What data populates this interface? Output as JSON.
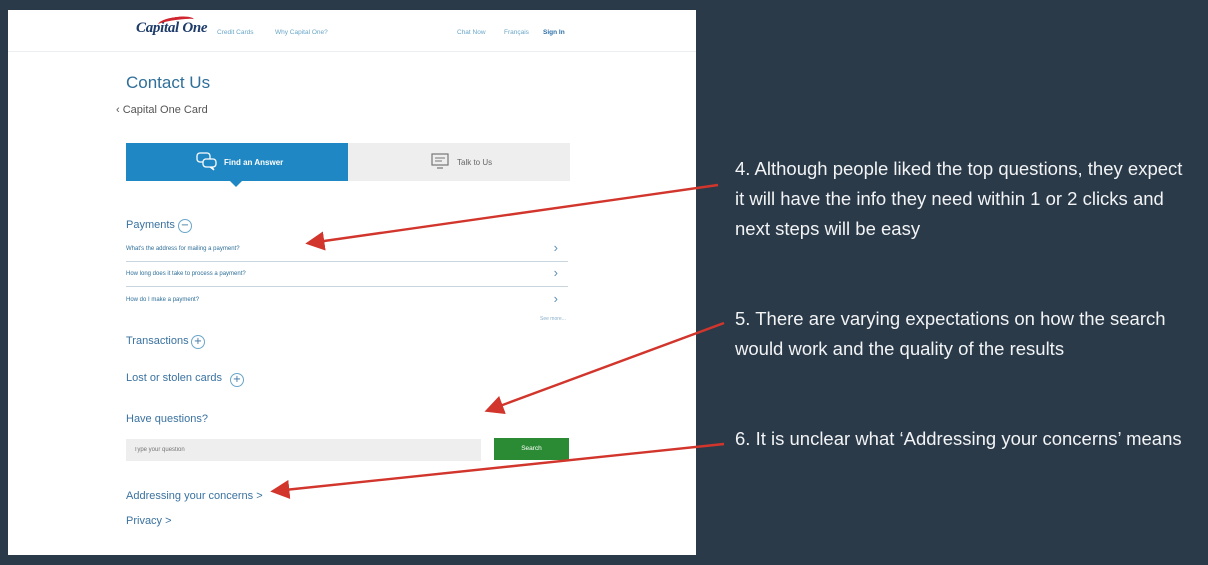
{
  "header": {
    "logo_text": "Capital One",
    "nav": [
      "Credit Cards",
      "Why Capital One?"
    ],
    "right_links": [
      "Chat Now",
      "Français",
      "Sign In"
    ]
  },
  "page": {
    "title": "Contact Us",
    "back_link": "Capital One Card"
  },
  "tabs": {
    "find": "Find an Answer",
    "talk": "Talk to Us"
  },
  "payments": {
    "heading": "Payments",
    "toggle": "−",
    "questions": [
      "What's the address for mailing a payment?",
      "How long does it take to process a payment?",
      "How do I make a payment?"
    ],
    "see_more": "See more..."
  },
  "sections": {
    "transactions": "Transactions",
    "lost_stolen": "Lost or stolen cards",
    "expand": "+"
  },
  "search": {
    "heading": "Have questions?",
    "placeholder": "Type your question",
    "button": "Search"
  },
  "footer": {
    "concerns": "Addressing your concerns >",
    "privacy": "Privacy >"
  },
  "notes": [
    "4. Although people liked the top questions, they expect it will have the info they need within 1 or 2 clicks and next steps will be easy",
    "5. There are varying expectations on how the search would work and the quality of the results",
    "6. It is unclear what ‘Addressing your concerns’ means"
  ],
  "colors": {
    "background": "#2b3a49",
    "tab_active": "#1f87c3",
    "search_button": "#2b8b34",
    "arrow": "#d2352c",
    "link": "#3a72a0"
  }
}
